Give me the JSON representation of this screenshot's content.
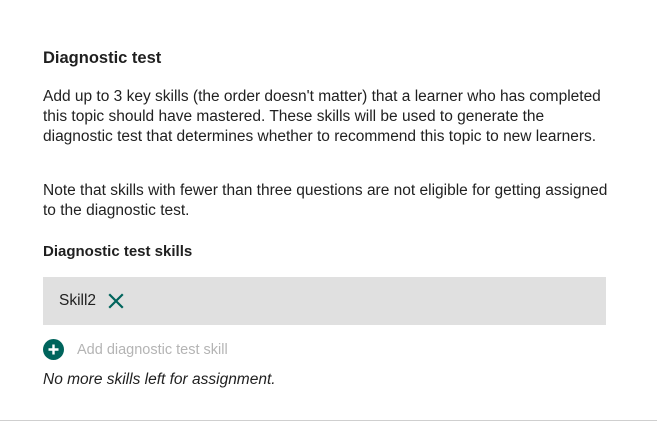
{
  "section": {
    "title": "Diagnostic test",
    "description": "Add up to 3 key skills (the order doesn't matter) that a learner who has completed this topic should have mastered. These skills will be used to generate the diagnostic test that determines whether to recommend this topic to new learners.",
    "note": "Note that skills with fewer than three questions are not eligible for getting assigned to the diagnostic test."
  },
  "skills": {
    "heading": "Diagnostic test skills",
    "items": [
      {
        "name": "Skill2",
        "remove_icon": "close-icon"
      }
    ],
    "add_label": "Add diagnostic test skill",
    "add_icon": "plus-circle-icon",
    "empty_message": "No more skills left for assignment."
  },
  "colors": {
    "accent": "#00645c",
    "chip_background": "#e0e0e0",
    "disabled_text": "#b4b4b4"
  }
}
